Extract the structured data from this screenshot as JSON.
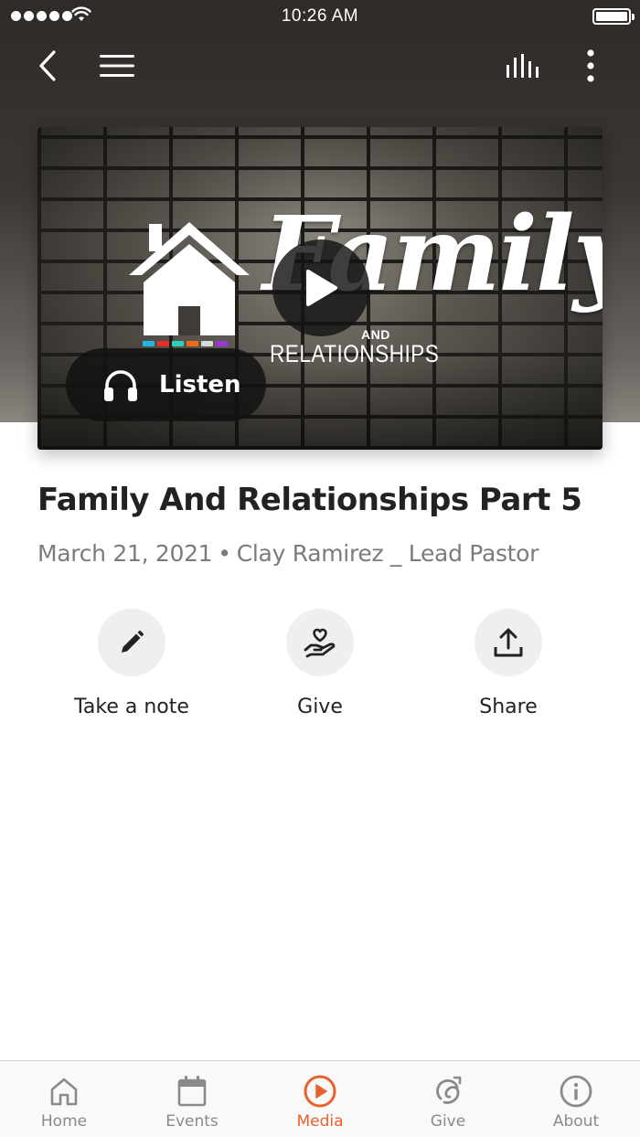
{
  "status_bar": {
    "time": "10:26 AM"
  },
  "nav": {
    "back_icon": "chevron-left-icon",
    "menu_icon": "hamburger-menu-icon",
    "audio_icon": "equalizer-icon",
    "more_icon": "vertical-dots-icon"
  },
  "media": {
    "artwork_title": "Family",
    "artwork_and": "AND",
    "artwork_subtitle": "RELATIONSHIPS",
    "listen_label": "Listen"
  },
  "sermon": {
    "title": "Family And Relationships Part 5",
    "date": "March 21, 2021",
    "separator": "•",
    "speaker": "Clay Ramirez _ Lead Pastor"
  },
  "actions": [
    {
      "label": "Take a note",
      "icon": "pencil-icon"
    },
    {
      "label": "Give",
      "icon": "hand-heart-icon"
    },
    {
      "label": "Share",
      "icon": "share-upload-icon"
    }
  ],
  "tabs": [
    {
      "label": "Home",
      "icon": "home-icon",
      "active": false
    },
    {
      "label": "Events",
      "icon": "calendar-icon",
      "active": false
    },
    {
      "label": "Media",
      "icon": "play-circle-icon",
      "active": true
    },
    {
      "label": "Give",
      "icon": "give-icon",
      "active": false
    },
    {
      "label": "About",
      "icon": "info-icon",
      "active": false
    }
  ],
  "colors": {
    "accent": "#e8612c",
    "tab_inactive": "#8a8a8a",
    "action_bg": "#efefef"
  }
}
